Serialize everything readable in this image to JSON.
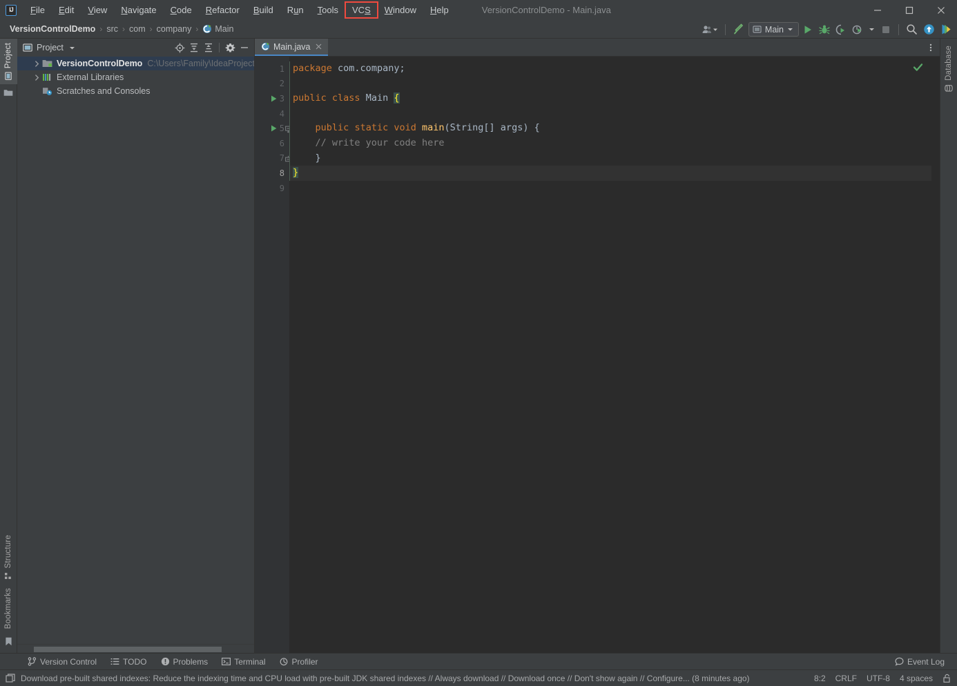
{
  "window": {
    "title": "VersionControlDemo - Main.java",
    "logo": "intellij-idea-logo",
    "minimize": "minimize-icon",
    "maximize": "maximize-icon",
    "close": "close-icon"
  },
  "menubar": {
    "items": [
      {
        "label": "File",
        "mnemonic": "F",
        "highlighted": false
      },
      {
        "label": "Edit",
        "mnemonic": "E",
        "highlighted": false
      },
      {
        "label": "View",
        "mnemonic": "V",
        "highlighted": false
      },
      {
        "label": "Navigate",
        "mnemonic": "N",
        "highlighted": false
      },
      {
        "label": "Code",
        "mnemonic": "C",
        "highlighted": false
      },
      {
        "label": "Refactor",
        "mnemonic": "R",
        "highlighted": false
      },
      {
        "label": "Build",
        "mnemonic": "B",
        "highlighted": false
      },
      {
        "label": "Run",
        "mnemonic": "u",
        "highlighted": false
      },
      {
        "label": "Tools",
        "mnemonic": "T",
        "highlighted": false
      },
      {
        "label": "VCS",
        "mnemonic": "S",
        "highlighted": true
      },
      {
        "label": "Window",
        "mnemonic": "W",
        "highlighted": false
      },
      {
        "label": "Help",
        "mnemonic": "H",
        "highlighted": false
      }
    ],
    "highlight_color": "#F04A3F"
  },
  "navbar": {
    "breadcrumbs": [
      {
        "label": "VersionControlDemo",
        "bold": true,
        "icon": null
      },
      {
        "label": "src",
        "bold": false,
        "icon": null
      },
      {
        "label": "com",
        "bold": false,
        "icon": null
      },
      {
        "label": "company",
        "bold": false,
        "icon": null
      },
      {
        "label": "Main",
        "bold": false,
        "icon": "java-class-icon"
      }
    ],
    "separator": "›",
    "toolbar": {
      "users_icon": "users-dropdown-icon",
      "build_icon": "build-hammer-icon",
      "run_config": {
        "label": "Main",
        "icon": "run-config-icon",
        "caret": "chevron-down-icon"
      },
      "run_icon": "run-play-icon",
      "debug_icon": "debug-bug-icon",
      "run_coverage_icon": "run-with-coverage-icon",
      "profile_icon": "profile-icon",
      "stop_icon": "stop-icon",
      "search_icon": "search-everywhere-icon",
      "update_icon": "update-project-icon",
      "plugins_icon": "colorful-plugin-icon"
    }
  },
  "left_stripe": {
    "top": [
      {
        "label": "Project",
        "icon": "project-icon",
        "selected": true
      }
    ],
    "top_icons": [
      {
        "label": "",
        "icon": "folder-icon"
      }
    ],
    "bottom": [
      {
        "label": "Structure",
        "icon": "structure-icon",
        "selected": false
      },
      {
        "label": "Bookmarks",
        "icon": "bookmarks-icon",
        "selected": false
      }
    ]
  },
  "right_stripe": {
    "items": [
      {
        "label": "Database",
        "icon": "database-icon",
        "selected": false
      }
    ]
  },
  "project_panel": {
    "title": "Project",
    "title_icon": "project-view-icon",
    "caret": "chevron-down-icon",
    "actions": [
      {
        "name": "select-opened-file-icon",
        "tooltip": "Select Opened File"
      },
      {
        "name": "expand-all-icon",
        "tooltip": "Expand All"
      },
      {
        "name": "collapse-all-icon",
        "tooltip": "Collapse All"
      },
      {
        "name": "settings-gear-icon",
        "tooltip": "Settings"
      },
      {
        "name": "hide-icon",
        "tooltip": "Hide"
      }
    ],
    "tree": [
      {
        "label": "VersionControlDemo",
        "path": "C:\\Users\\Family\\IdeaProjects\\Versi",
        "icon": "project-module-icon",
        "bold": true,
        "expandable": true,
        "expanded": false,
        "selected": true
      },
      {
        "label": "External Libraries",
        "path": "",
        "icon": "external-libraries-icon",
        "bold": false,
        "expandable": true,
        "expanded": false,
        "selected": false
      },
      {
        "label": "Scratches and Consoles",
        "path": "",
        "icon": "scratches-icon",
        "bold": false,
        "expandable": false,
        "expanded": false,
        "selected": false
      }
    ]
  },
  "editor": {
    "tabs": [
      {
        "label": "Main.java",
        "icon": "java-class-icon",
        "active": true,
        "close": "close-icon"
      }
    ],
    "tab_options_icon": "more-vertical-icon",
    "inspection_status": "no-problems-checkmark-icon",
    "line_numbers": [
      "1",
      "2",
      "3",
      "4",
      "5",
      "6",
      "7",
      "8",
      "9"
    ],
    "current_line": 8,
    "gutter_markers": [
      {
        "line": 3,
        "type": "run-gutter-icon"
      },
      {
        "line": 5,
        "type": "run-gutter-icon"
      },
      {
        "line": 5,
        "type": "fold-start-icon"
      },
      {
        "line": 7,
        "type": "fold-end-icon"
      }
    ],
    "code": [
      {
        "line": 1,
        "tokens": [
          {
            "t": "package",
            "c": "kw"
          },
          {
            "t": " ",
            "c": "plain"
          },
          {
            "t": "com.company;",
            "c": "plain"
          }
        ]
      },
      {
        "line": 2,
        "tokens": []
      },
      {
        "line": 3,
        "tokens": [
          {
            "t": "public",
            "c": "kw"
          },
          {
            "t": " ",
            "c": "plain"
          },
          {
            "t": "class",
            "c": "kw"
          },
          {
            "t": " ",
            "c": "plain"
          },
          {
            "t": "Main",
            "c": "plain"
          },
          {
            "t": " ",
            "c": "plain"
          },
          {
            "t": "{",
            "c": "brace-hl"
          }
        ]
      },
      {
        "line": 4,
        "tokens": []
      },
      {
        "line": 5,
        "tokens": [
          {
            "t": "    ",
            "c": "plain"
          },
          {
            "t": "public",
            "c": "kw"
          },
          {
            "t": " ",
            "c": "plain"
          },
          {
            "t": "static",
            "c": "kw"
          },
          {
            "t": " ",
            "c": "plain"
          },
          {
            "t": "void",
            "c": "kw"
          },
          {
            "t": " ",
            "c": "plain"
          },
          {
            "t": "main",
            "c": "fn"
          },
          {
            "t": "(String[] args) {",
            "c": "plain"
          }
        ]
      },
      {
        "line": 6,
        "tokens": [
          {
            "t": "    ",
            "c": "plain"
          },
          {
            "t": "// write your code here",
            "c": "cmt"
          }
        ]
      },
      {
        "line": 7,
        "tokens": [
          {
            "t": "    }",
            "c": "plain"
          }
        ]
      },
      {
        "line": 8,
        "tokens": [
          {
            "t": "}",
            "c": "brace-hl"
          }
        ]
      },
      {
        "line": 9,
        "tokens": []
      }
    ]
  },
  "toolwindow_bar": {
    "items": [
      {
        "label": "Version Control",
        "icon": "vcs-branch-icon"
      },
      {
        "label": "TODO",
        "icon": "todo-list-icon"
      },
      {
        "label": "Problems",
        "icon": "problems-icon"
      },
      {
        "label": "Terminal",
        "icon": "terminal-icon"
      },
      {
        "label": "Profiler",
        "icon": "profiler-icon"
      }
    ],
    "right": {
      "label": "Event Log",
      "icon": "event-log-icon"
    }
  },
  "status_bar": {
    "notification_icon": "notification-balloon-icon",
    "message": "Download pre-built shared indexes: Reduce the indexing time and CPU load with pre-built JDK shared indexes // Always download // Download once // Don't show again // Configure... (8 minutes ago)",
    "caret_position": "8:2",
    "line_separator": "CRLF",
    "encoding": "UTF-8",
    "indent": "4 spaces",
    "lock_icon": "read-write-lock-icon"
  },
  "colors": {
    "bg_chrome": "#3C3F41",
    "bg_editor": "#2B2B2B",
    "bg_gutter": "#313335",
    "selection_blue": "#2E3C4F",
    "accent_green": "#499C54",
    "keyword_orange": "#CC7832",
    "text_default": "#A9B7C6",
    "comment_gray": "#808080",
    "method_yellow": "#FFC66D",
    "highlight_red": "#F04A3F",
    "tab_underline": "#4A88C7"
  }
}
